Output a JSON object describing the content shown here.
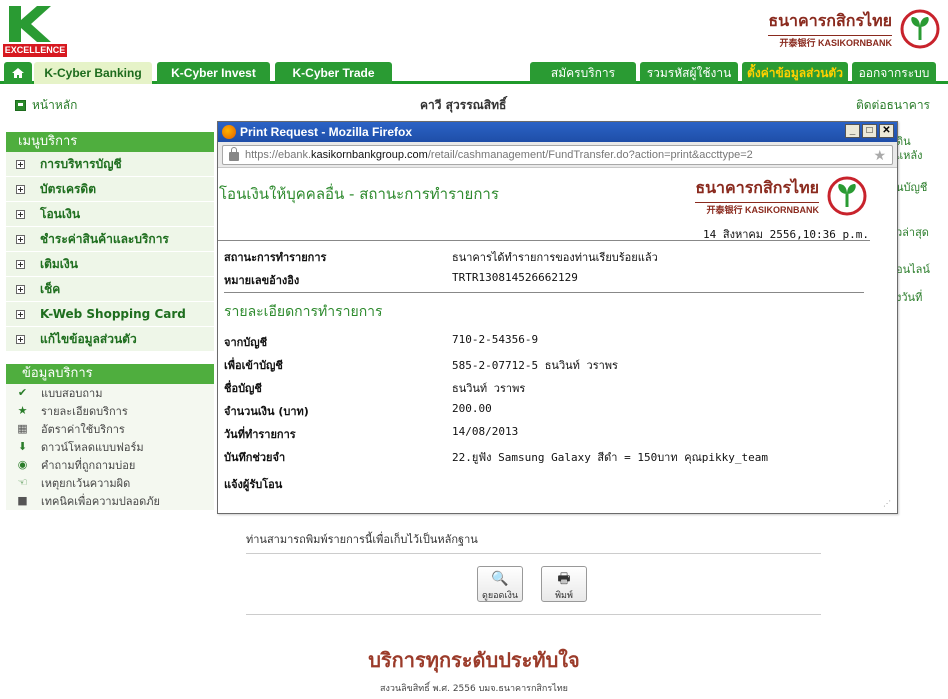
{
  "header": {
    "logo_tag": "EXCELLENCE",
    "bank_name_th": "ธนาคารกสิกรไทย",
    "bank_name_en": "开泰银行 KASIKORNBANK"
  },
  "tabs": {
    "left": [
      "K-Cyber Banking",
      "K-Cyber Invest",
      "K-Cyber Trade"
    ],
    "right": [
      "สมัครบริการ",
      "รวมรหัสผู้ใช้งาน",
      "ตั้งค่าข้อมูลส่วนตัว",
      "ออกจากระบบ"
    ]
  },
  "subbar": {
    "home": "หน้าหลัก",
    "user": "คาวี สุวรรณสิทธิ์",
    "contact": "ติดต่อธนาคาร"
  },
  "menu": {
    "title": "เมนูบริการ",
    "items": [
      "การบริหารบัญชี",
      "บัตรเครดิต",
      "โอนเงิน",
      "ชำระค่าสินค้าและบริการ",
      "เติมเงิน",
      "เช็ค",
      "K-Web Shopping Card",
      "แก้ไขข้อมูลส่วนตัว"
    ]
  },
  "services": {
    "title": "ข้อมูลบริการ",
    "items": [
      {
        "label": "แบบสอบถาม",
        "icon": "check-icon"
      },
      {
        "label": "รายละเอียดบริการ",
        "icon": "star-icon"
      },
      {
        "label": "อัตราค่าใช้บริการ",
        "icon": "calculator-icon"
      },
      {
        "label": "ดาวน์โหลดแบบฟอร์ม",
        "icon": "download-icon"
      },
      {
        "label": "คำถามที่ถูกถามบ่อย",
        "icon": "faq-icon"
      },
      {
        "label": "เหตุยกเว้นความผิด",
        "icon": "hand-icon"
      },
      {
        "label": "เทคนิคเพื่อความปลอดภัย",
        "icon": "lock-icon"
      }
    ]
  },
  "right_fragments": [
    "ดิน",
    "แหลัง",
    "นบัญชี",
    "วล่าสุด",
    "อนไลน์",
    "ังวันที่"
  ],
  "popup": {
    "window_title": "Print Request - Mozilla Firefox",
    "url_prefix": "https://ebank.",
    "url_host": "kasikornbankgroup.com",
    "url_path": "/retail/cashmanagement/FundTransfer.do?action=print&accttype=2",
    "page_title": "โอนเงินให้บุคคลอื่น - สถานะการทำรายการ",
    "date": "14 สิงหาคม 2556,10:36 p.m.",
    "status_label": "สถานะการทำรายการ",
    "status_value": "ธนาคารได้ทำรายการของท่านเรียบร้อยแล้ว",
    "ref_label": "หมายเลขอ้างอิง",
    "ref_value": "TRTR130814526662129",
    "section_title": "รายละเอียดการทำรายการ",
    "details": [
      {
        "label": "จากบัญชี",
        "value": "710-2-54356-9"
      },
      {
        "label": "เพื่อเข้าบัญชี",
        "value": "585-2-07712-5 ธนวินท์ วราพร"
      },
      {
        "label": "ชื่อบัญชี",
        "value": "ธนวินท์ วราพร"
      },
      {
        "label": "จำนวนเงิน (บาท)",
        "value": "200.00"
      },
      {
        "label": "วันที่ทำรายการ",
        "value": "14/08/2013"
      },
      {
        "label": "บันทึกช่วยจำ",
        "value": "22.ยูฟัง Samsung Galaxy สีดำ = 150บาท คุณpikky_team"
      },
      {
        "label": "แจ้งผู้รับโอน",
        "value": ""
      }
    ]
  },
  "below": {
    "note": "ท่านสามารถพิมพ์รายการนี้เพื่อเก็บไว้เป็นหลักฐาน",
    "btn_view": "ดูยอดเงิน",
    "btn_print": "พิมพ์"
  },
  "footer": {
    "slogan": "บริการทุกระดับประทับใจ",
    "copyright": "สงวนลิขสิทธิ์ พ.ศ. 2556 บมจ.ธนาคารกสิกรไทย"
  }
}
